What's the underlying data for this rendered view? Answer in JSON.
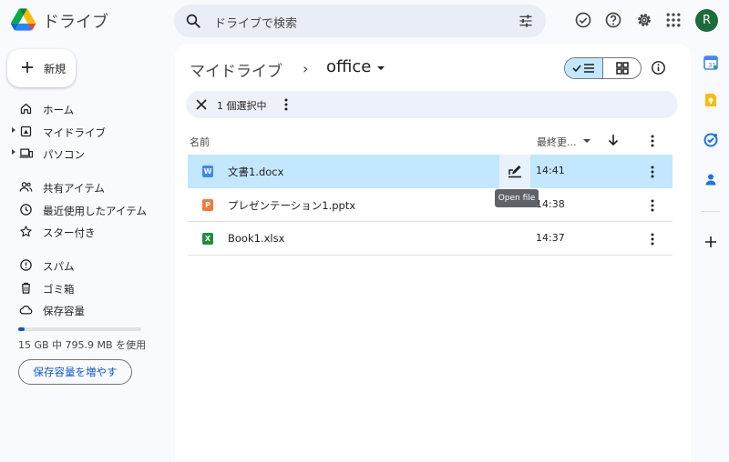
{
  "header": {
    "app_title": "ドライブ",
    "search_placeholder": "ドライブで検索",
    "avatar_initial": "R"
  },
  "sidebar": {
    "new_label": "新規",
    "items": [
      {
        "label": "ホーム",
        "icon": "home-icon"
      },
      {
        "label": "マイドライブ",
        "icon": "my-drive-icon"
      },
      {
        "label": "パソコン",
        "icon": "computers-icon"
      },
      {
        "label": "共有アイテム",
        "icon": "shared-icon"
      },
      {
        "label": "最近使用したアイテム",
        "icon": "recent-icon"
      },
      {
        "label": "スター付き",
        "icon": "star-icon"
      },
      {
        "label": "スパム",
        "icon": "spam-icon"
      },
      {
        "label": "ゴミ箱",
        "icon": "trash-icon"
      },
      {
        "label": "保存容量",
        "icon": "cloud-icon"
      }
    ],
    "storage": {
      "used_fraction": 0.05,
      "text": "15 GB 中 795.9 MB を使用",
      "button": "保存容量を増やす"
    }
  },
  "main": {
    "breadcrumb_root": "マイドライブ",
    "breadcrumb_sep": "›",
    "breadcrumb_current": "office",
    "selection_text": "1 個選択中",
    "columns": {
      "name": "名前",
      "modified": "最終更..."
    },
    "files": [
      {
        "name": "文書1.docx",
        "type_letter": "W",
        "type_color": "#4285f4",
        "time": "14:41",
        "selected": true
      },
      {
        "name": "プレゼンテーション1.pptx",
        "type_letter": "P",
        "type_color": "#f4793b",
        "time": "14:38",
        "selected": false
      },
      {
        "name": "Book1.xlsx",
        "type_letter": "X",
        "type_color": "#1e8e3e",
        "time": "14:37",
        "selected": false
      }
    ],
    "tooltip": "Open file"
  },
  "colors": {
    "accent": "#0b57d0",
    "selected_row": "#c2e7ff"
  }
}
